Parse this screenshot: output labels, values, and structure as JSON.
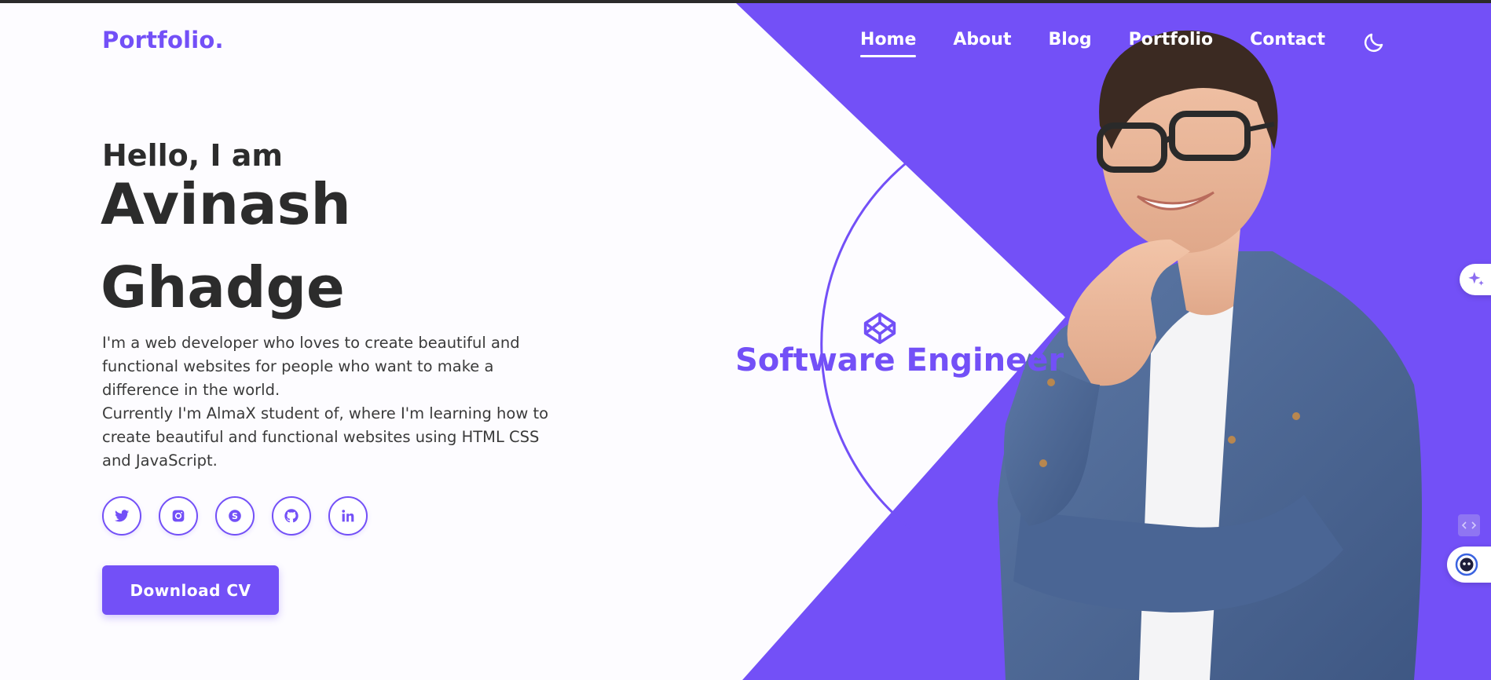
{
  "header": {
    "logo": "Portfolio.",
    "nav": [
      {
        "label": "Home",
        "active": true
      },
      {
        "label": "About",
        "active": false
      },
      {
        "label": "Blog",
        "active": false
      },
      {
        "label": "Portfolio",
        "active": false
      },
      {
        "label": "Contact",
        "active": false
      }
    ],
    "theme_toggle_icon": "moon-icon"
  },
  "hero": {
    "greeting": "Hello, I am",
    "first_name": "Avinash",
    "last_name": "Ghadge",
    "bio_line1": "I'm a web developer who loves to create beautiful and functional websites for people who want to make a difference in the world.",
    "bio_line2": "Currently I'm AlmaX student of, where I'm learning how to create beautiful and functional websites using HTML CSS and JavaScript.",
    "socials": [
      "twitter-icon",
      "instagram-icon",
      "skype-icon",
      "github-icon",
      "linkedin-icon"
    ],
    "cta_label": "Download CV",
    "role": "Software Engineer",
    "role_icon": "codepen-icon"
  },
  "colors": {
    "accent": "#7350f7",
    "text": "#2c2c2c",
    "background": "#fdfcff"
  }
}
